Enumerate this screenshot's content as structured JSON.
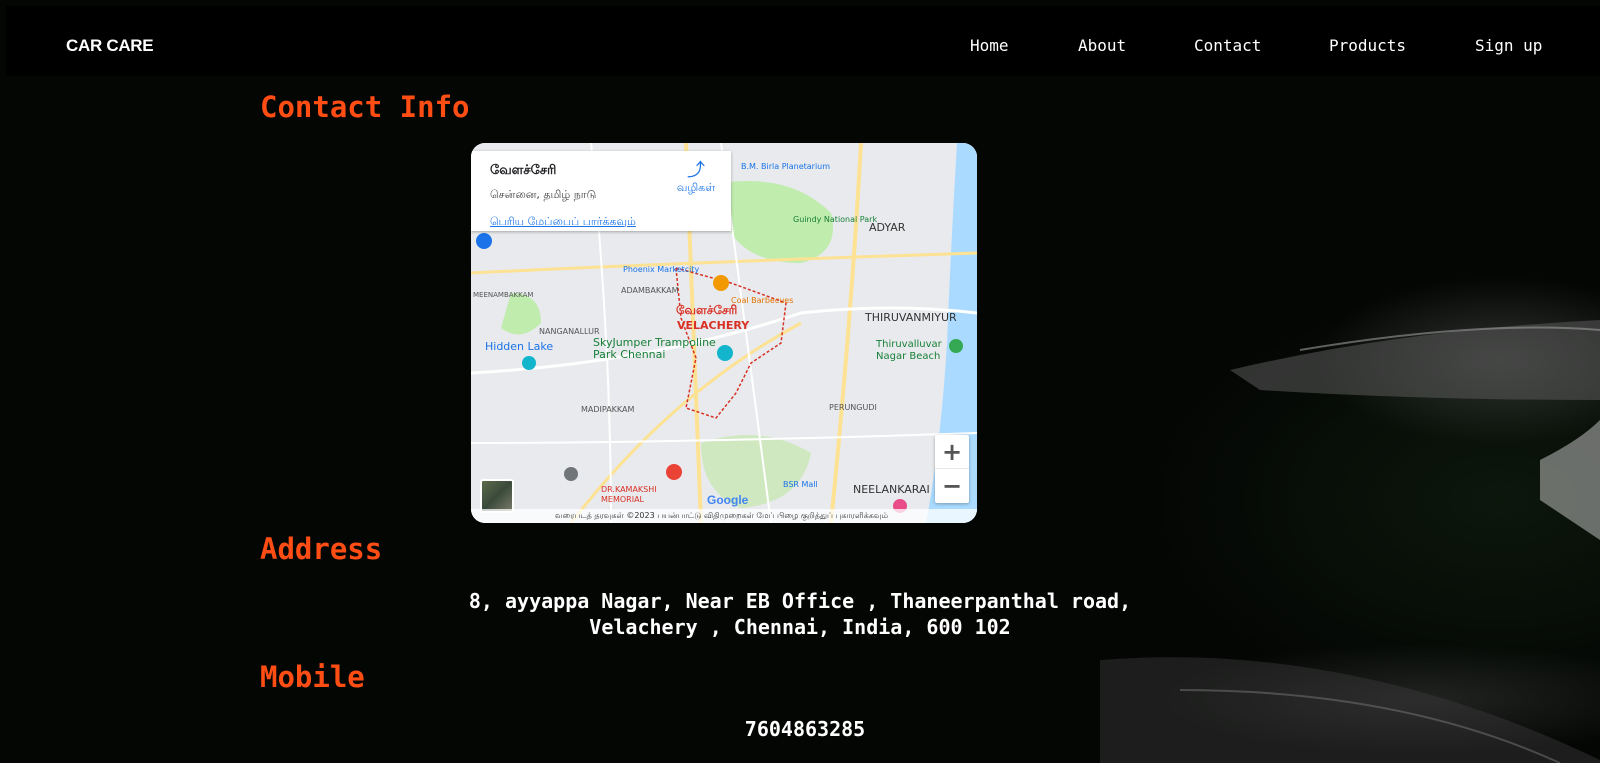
{
  "brand": {
    "logo": "CAR CARE"
  },
  "nav": {
    "items": [
      "Home",
      "About",
      "Contact",
      "Products",
      "Sign up"
    ]
  },
  "contact": {
    "heading": "Contact Info",
    "address_heading": "Address",
    "address_line1": "8, ayyappa Nagar, Near EB Office , Thaneerpanthal road,",
    "address_line2": "Velachery , Chennai, India, 600 102",
    "mobile_heading": "Mobile",
    "mobile_number": "7604863285"
  },
  "map": {
    "card_title": "வேளச்சேரி",
    "card_subtitle": "சென்னை, தமிழ் நாடு",
    "directions_label": "வழிகள்",
    "view_larger_label": "பெரிய மேப்பைப் பார்க்கவும்",
    "zoom_in": "+",
    "zoom_out": "−",
    "google_label": "Google",
    "footer_text": "வரைபடத் தரவுகள் ©2023   பயன்பாட்டு விதிமுறைகள்   மேப் பிழை குறித்துப் புகாரளிக்கவும்",
    "place_labels": {
      "velachery_ta": "வேளச்சேரி",
      "velachery_en": "VELACHERY",
      "guindy": "Guindy National Park",
      "adyar": "ADYAR",
      "thiruvanmiyur": "THIRUVANMIYUR",
      "hidden_lake": "Hidden Lake",
      "skyjumper": "SkyJumper Trampoline Park Chennai",
      "madipakkam": "MADIPAKKAM",
      "perungudi": "PERUNGUDI",
      "neelankarai": "NEELANKARAI",
      "thiruvalluvar": "Thiruvalluvar Nagar Beach",
      "phoenix": "Phoenix Marketcity",
      "adambakkam": "ADAMBAKKAM",
      "nanganallur": "NANGANALLUR",
      "meenambakkam": "MEENAMBAKKAM",
      "coal": "Coal Barbecues",
      "kamakshi": "DR.KAMAKSHI MEMORIAL",
      "bsr": "BSR Mall",
      "birla": "B.M. Birla Planetarium"
    },
    "colors": {
      "water": "#aadaff",
      "park": "#c0ecae",
      "road": "#fde293",
      "boundary": "#d93025"
    }
  },
  "colors": {
    "accent": "#ff4d14",
    "background": "#040604"
  }
}
